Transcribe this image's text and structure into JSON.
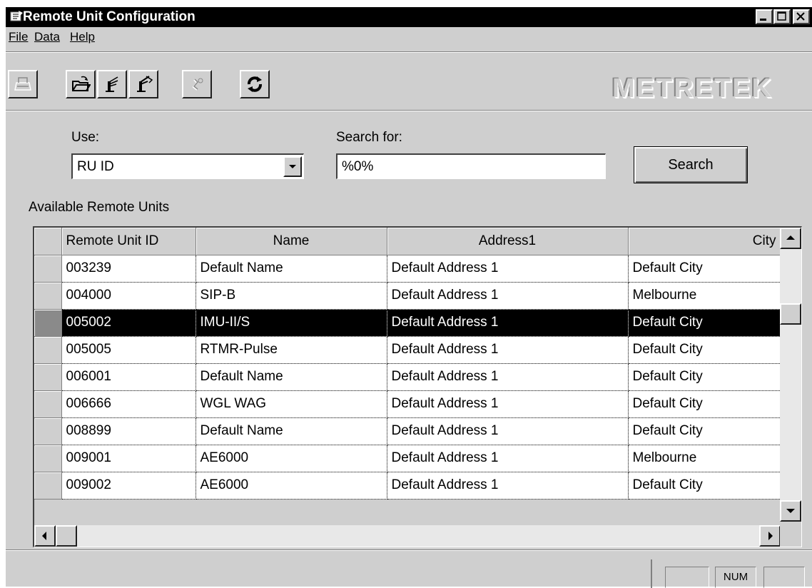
{
  "window": {
    "title": "Remote Unit Configuration"
  },
  "menu": [
    "File",
    "Data",
    "Help"
  ],
  "toolbar": {
    "buttons": [
      {
        "icon": "print-icon",
        "enabled": false
      },
      {
        "icon": "open-folder-icon",
        "enabled": true
      },
      {
        "icon": "antenna-icon",
        "enabled": true
      },
      {
        "icon": "antenna-alt-icon",
        "enabled": true
      },
      {
        "icon": "settings-icon",
        "enabled": false
      },
      {
        "icon": "refresh-icon",
        "enabled": true
      }
    ],
    "logo": "METRETEK"
  },
  "search": {
    "use_label": "Use:",
    "use_value": "RU ID",
    "search_label": "Search for:",
    "search_value": "%0%",
    "button": "Search"
  },
  "units": {
    "label": "Available Remote Units",
    "columns": [
      "Remote Unit ID",
      "Name",
      "Address1",
      "City"
    ],
    "selected_index": 2,
    "rows": [
      {
        "id": "003239",
        "name": "Default Name",
        "address": "Default Address 1",
        "city": "Default City"
      },
      {
        "id": "004000",
        "name": "SIP-B",
        "address": "Default Address 1",
        "city": "Melbourne"
      },
      {
        "id": "005002",
        "name": "IMU-II/S",
        "address": "Default Address 1",
        "city": "Default City"
      },
      {
        "id": "005005",
        "name": "RTMR-Pulse",
        "address": "Default Address 1",
        "city": "Default City"
      },
      {
        "id": "006001",
        "name": "Default Name",
        "address": "Default Address 1",
        "city": "Default City"
      },
      {
        "id": "006666",
        "name": "WGL WAG",
        "address": "Default Address 1",
        "city": "Default City"
      },
      {
        "id": "008899",
        "name": "Default Name",
        "address": "Default Address 1",
        "city": "Default City"
      },
      {
        "id": "009001",
        "name": "AE6000",
        "address": "Default Address 1",
        "city": "Melbourne"
      },
      {
        "id": "009002",
        "name": "AE6000",
        "address": "Default Address 1",
        "city": "Default City"
      }
    ]
  },
  "status": {
    "num": "NUM"
  }
}
